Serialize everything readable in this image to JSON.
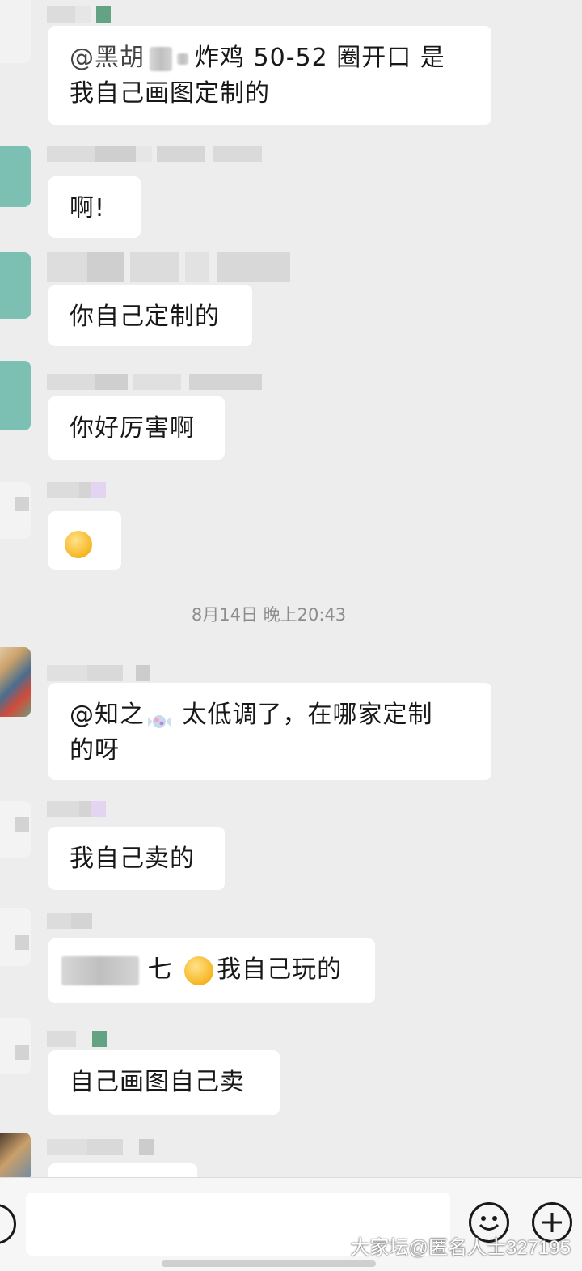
{
  "messages": [
    {
      "text_segments": [
        "@黑胡",
        "炸鸡 50-52 圈开口  是",
        "我自己画图定制的"
      ]
    },
    {
      "text": "啊!"
    },
    {
      "text": "你自己定制的"
    },
    {
      "text": "你好厉害啊"
    },
    {
      "emoji": "laughing-emoji"
    },
    {
      "text_a": "@知之",
      "text_b": " 太低调了，在哪家定制",
      "text_c": "的呀"
    },
    {
      "text": "我自己卖的"
    },
    {
      "text_a": "七 ",
      "text_b": "我自己玩的"
    },
    {
      "text": "自己画图自己卖"
    }
  ],
  "timestamp": "8月14日 晚上20:43",
  "watermark": "大家坛@匿名人士327195",
  "colors": {
    "background": "#ededed",
    "bubble": "#ffffff",
    "text": "#181818",
    "teal_avatar": "#7cc0b4",
    "time": "#8d8d8d"
  }
}
